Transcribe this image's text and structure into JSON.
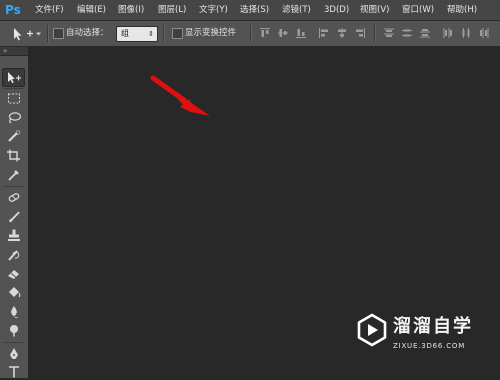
{
  "app": {
    "logo_text": "Ps"
  },
  "menu": {
    "items": [
      {
        "label": "文件(F)"
      },
      {
        "label": "编辑(E)"
      },
      {
        "label": "图像(I)"
      },
      {
        "label": "图层(L)"
      },
      {
        "label": "文字(Y)"
      },
      {
        "label": "选择(S)"
      },
      {
        "label": "滤镜(T)"
      },
      {
        "label": "3D(D)"
      },
      {
        "label": "视图(V)"
      },
      {
        "label": "窗口(W)"
      },
      {
        "label": "帮助(H)"
      }
    ]
  },
  "options": {
    "auto_select_label": "自动选择：",
    "auto_select_checked": false,
    "layer_select_value": "组",
    "show_transform_label": "显示变换控件",
    "show_transform_checked": false
  },
  "tools_header": "»",
  "tools": [
    {
      "icon": "move-tool-icon",
      "active": true
    },
    {
      "icon": "marquee-tool-icon"
    },
    {
      "icon": "lasso-tool-icon"
    },
    {
      "icon": "quick-selection-tool-icon"
    },
    {
      "icon": "crop-tool-icon"
    },
    {
      "icon": "eyedropper-tool-icon"
    },
    {
      "icon": "spot-healing-tool-icon"
    },
    {
      "icon": "brush-tool-icon"
    },
    {
      "icon": "clone-stamp-tool-icon"
    },
    {
      "icon": "history-brush-tool-icon"
    },
    {
      "icon": "eraser-tool-icon"
    },
    {
      "icon": "paint-bucket-tool-icon"
    },
    {
      "icon": "blur-tool-icon"
    },
    {
      "icon": "dodge-tool-icon"
    },
    {
      "icon": "pen-tool-icon"
    },
    {
      "icon": "type-tool-icon"
    }
  ],
  "annotation": {
    "icon": "red-arrow-icon",
    "color": "#e01010"
  },
  "watermark": {
    "title": "溜溜自学",
    "url": "ZIXUE.3D66.COM",
    "icon": "play-logo-icon"
  },
  "colors": {
    "menubar": "#464646",
    "optionsbar": "#535353",
    "canvas": "#282828",
    "logo": "#3aa6f5"
  }
}
